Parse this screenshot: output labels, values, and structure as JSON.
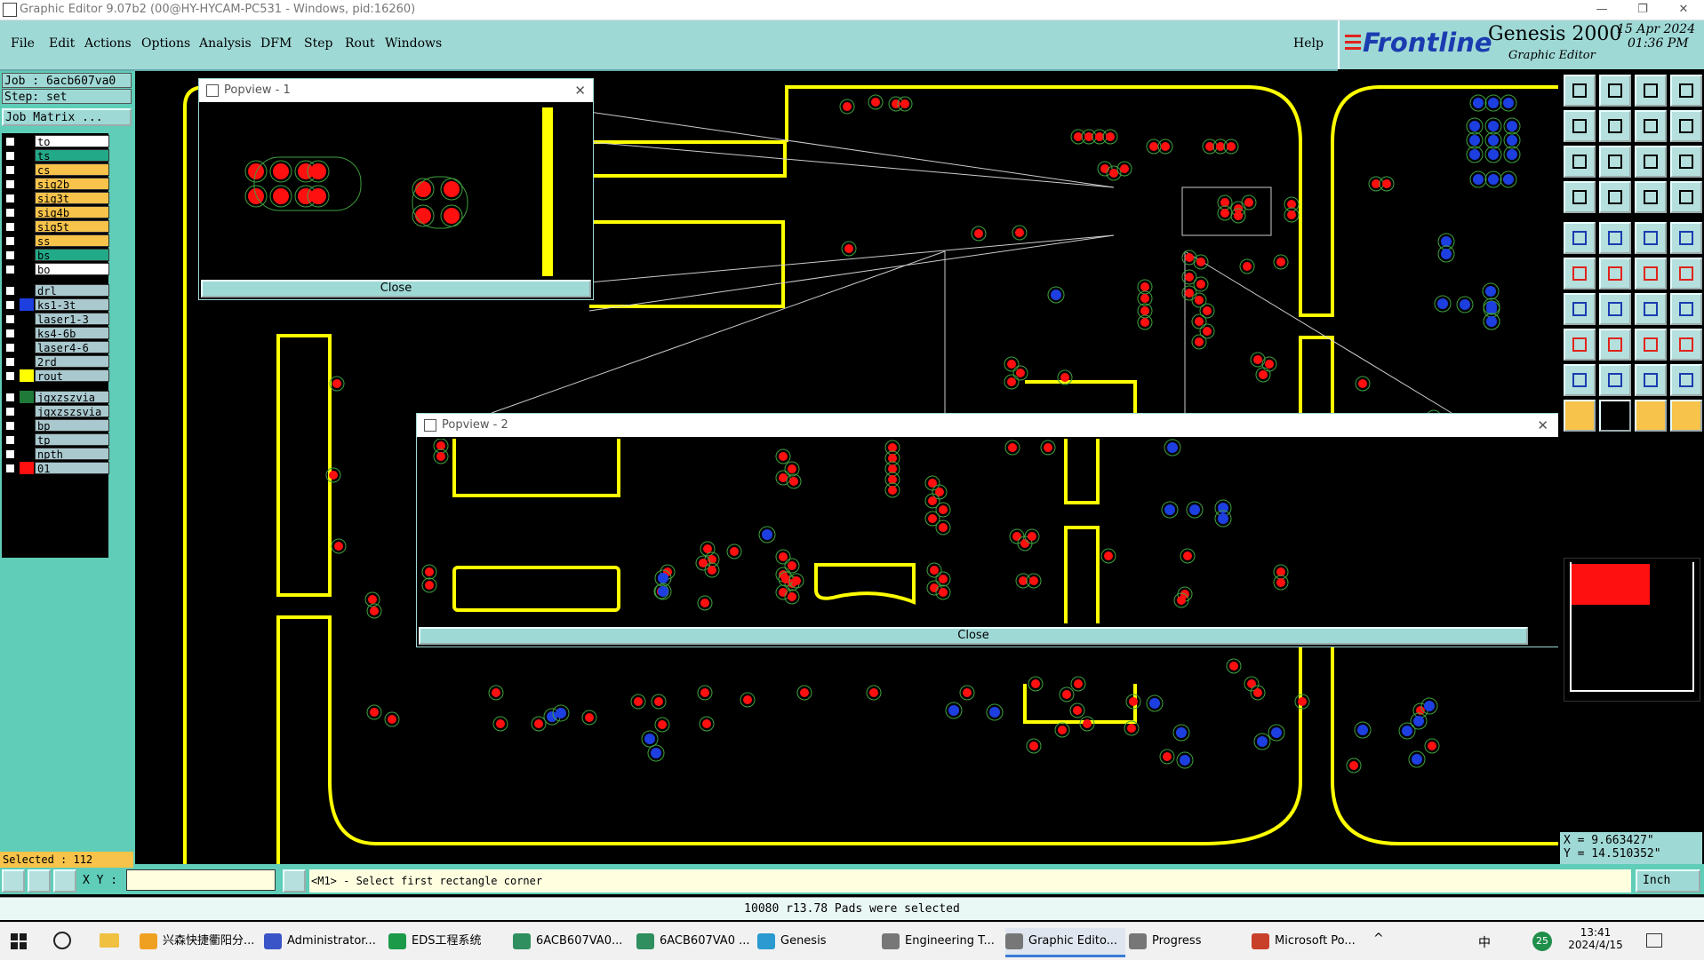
{
  "window": {
    "title": "Graphic Editor 9.07b2 (00@HY-HYCAM-PC531 - Windows, pid:16260)",
    "controls": [
      "—",
      "❐",
      "✕"
    ]
  },
  "menu": {
    "items": [
      "File",
      "Edit",
      "Actions",
      "Options",
      "Analysis",
      "DFM",
      "Step",
      "Rout",
      "Windows"
    ],
    "help": "Help"
  },
  "brand": {
    "logo": "Frontline",
    "product": "Genesis 2000",
    "subtitle": "Graphic Editor",
    "date": "15 Apr 2024",
    "time": "01:36 PM"
  },
  "job": {
    "job_label": "Job : 6acb607va0",
    "step_label": "Step: set",
    "matrix_button": "Job Matrix ..."
  },
  "layers": [
    {
      "name": "to",
      "swatch": "#000000",
      "bg": "#ffffff"
    },
    {
      "name": "ts",
      "swatch": "#000000",
      "bg": "#22aa88"
    },
    {
      "name": "cs",
      "swatch": "#000000",
      "bg": "#f7c34a"
    },
    {
      "name": "sig2b",
      "swatch": "#000000",
      "bg": "#f7c34a"
    },
    {
      "name": "sig3t",
      "swatch": "#000000",
      "bg": "#f7c34a"
    },
    {
      "name": "sig4b",
      "swatch": "#000000",
      "bg": "#f7c34a"
    },
    {
      "name": "sig5t",
      "swatch": "#000000",
      "bg": "#f7c34a"
    },
    {
      "name": "ss",
      "swatch": "#000000",
      "bg": "#f7c34a"
    },
    {
      "name": "bs",
      "swatch": "#000000",
      "bg": "#22aa88"
    },
    {
      "name": "bo",
      "swatch": "#000000",
      "bg": "#ffffff"
    },
    {
      "name": "drl",
      "swatch": "#000000",
      "bg": "#a9c9cf"
    },
    {
      "name": "ks1-3t",
      "swatch": "#1d3fe0",
      "bg": "#a9c9cf"
    },
    {
      "name": "laser1-3",
      "swatch": "#000000",
      "bg": "#a9c9cf"
    },
    {
      "name": "ks4-6b",
      "swatch": "#000000",
      "bg": "#a9c9cf"
    },
    {
      "name": "laser4-6",
      "swatch": "#000000",
      "bg": "#a9c9cf"
    },
    {
      "name": "2rd",
      "swatch": "#000000",
      "bg": "#a9c9cf"
    },
    {
      "name": "rout",
      "swatch": "#ffff00",
      "bg": "#a9c9cf"
    },
    {
      "name": "jgxzszvia",
      "swatch": "#1f7a3a",
      "bg": "#a9c9cf"
    },
    {
      "name": "jgxzszsvia",
      "swatch": "#000000",
      "bg": "#a9c9cf"
    },
    {
      "name": "bp",
      "swatch": "#000000",
      "bg": "#a9c9cf"
    },
    {
      "name": "tp",
      "swatch": "#000000",
      "bg": "#a9c9cf"
    },
    {
      "name": "npth",
      "swatch": "#000000",
      "bg": "#a9c9cf"
    },
    {
      "name": "01",
      "swatch": "#ff1010",
      "bg": "#a9c9cf"
    }
  ],
  "selected": "Selected : 112",
  "popup1": {
    "title": "Popview - 1",
    "close": "Close"
  },
  "popup2": {
    "title": "Popview - 2",
    "close": "Close"
  },
  "coords": {
    "x": "X = 9.663427\"",
    "y": "Y = 14.510352\""
  },
  "units": "Inch",
  "status": {
    "xy_label": "X Y :",
    "xy_value": "",
    "prompt": "<M1> - Select first rectangle corner",
    "message": "10080 r13.78 Pads were selected"
  },
  "taskbar": {
    "items": [
      {
        "label": "兴森快捷衢阳分...",
        "color": "#f0a020"
      },
      {
        "label": "Administrator...",
        "color": "#3a55c8"
      },
      {
        "label": "EDS工程系统",
        "color": "#1c9a4a"
      },
      {
        "label": "6ACB607VA0...",
        "color": "#2f8f5f"
      },
      {
        "label": "6ACB607VA0 ...",
        "color": "#2f8f5f"
      },
      {
        "label": "Genesis",
        "color": "#2a9ad0"
      },
      {
        "label": "Engineering T...",
        "color": "#777777"
      },
      {
        "label": "Graphic Edito...",
        "color": "#777777"
      },
      {
        "label": "Progress",
        "color": "#777777"
      },
      {
        "label": "Microsoft Po...",
        "color": "#c8402a"
      }
    ],
    "clock_time": "13:41",
    "clock_date": "2024/4/15",
    "ime": "中",
    "badge": "25"
  },
  "colors": {
    "rout": "#ffff00",
    "pad_red": "#ff1010",
    "pad_blue": "#1d3fe0",
    "panel": "#9fd9d6",
    "panel_dark": "#5fcdb8"
  }
}
